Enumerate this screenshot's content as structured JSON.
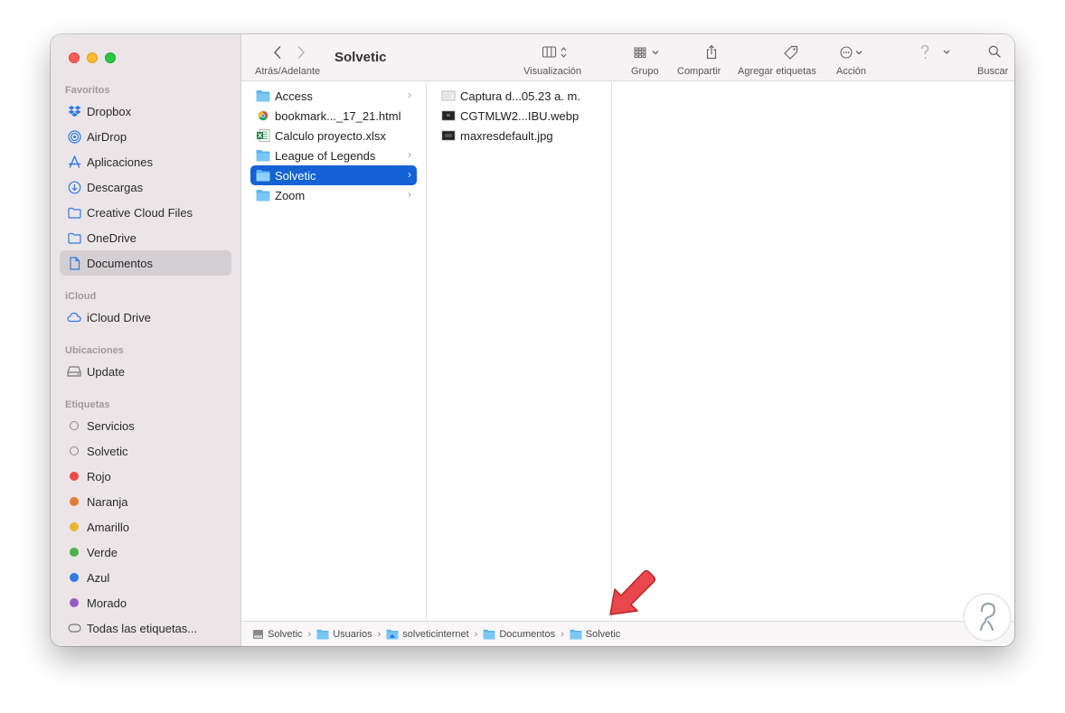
{
  "sidebar": {
    "favorites_title": "Favoritos",
    "favorites": [
      {
        "label": "Dropbox",
        "icon": "dropbox-icon"
      },
      {
        "label": "AirDrop",
        "icon": "airdrop-icon"
      },
      {
        "label": "Aplicaciones",
        "icon": "applications-icon"
      },
      {
        "label": "Descargas",
        "icon": "downloads-icon"
      },
      {
        "label": "Creative Cloud Files",
        "icon": "folder-icon"
      },
      {
        "label": "OneDrive",
        "icon": "folder-icon"
      },
      {
        "label": "Documentos",
        "icon": "document-icon"
      }
    ],
    "icloud_title": "iCloud",
    "icloud": [
      {
        "label": "iCloud Drive",
        "icon": "cloud-icon"
      }
    ],
    "locations_title": "Ubicaciones",
    "locations": [
      {
        "label": "Update",
        "icon": "disk-icon"
      }
    ],
    "tags_title": "Etiquetas",
    "tags": [
      {
        "label": "Servicios",
        "color": "hollow"
      },
      {
        "label": "Solvetic",
        "color": "hollow"
      },
      {
        "label": "Rojo",
        "color": "#ee4b45"
      },
      {
        "label": "Naranja",
        "color": "#e57c35"
      },
      {
        "label": "Amarillo",
        "color": "#e7b530"
      },
      {
        "label": "Verde",
        "color": "#47b349"
      },
      {
        "label": "Azul",
        "color": "#2f7ae5"
      },
      {
        "label": "Morado",
        "color": "#9a5bc6"
      },
      {
        "label": "Todas las etiquetas...",
        "color": "all"
      }
    ]
  },
  "toolbar": {
    "title": "Solvetic",
    "nav_label": "Atrás/Adelante",
    "view_label": "Visualización",
    "group_label": "Grupo",
    "share_label": "Compartir",
    "tags_label": "Agregar etiquetas",
    "action_label": "Acción",
    "search_label": "Buscar"
  },
  "column1": [
    {
      "label": "Access",
      "type": "folder",
      "chevron": true
    },
    {
      "label": "bookmark..._17_21.html",
      "type": "html",
      "chevron": false
    },
    {
      "label": "Calculo proyecto.xlsx",
      "type": "xlsx",
      "chevron": false
    },
    {
      "label": "League of Legends",
      "type": "folder",
      "chevron": true
    },
    {
      "label": "Solvetic",
      "type": "folder",
      "chevron": true,
      "selected": true
    },
    {
      "label": "Zoom",
      "type": "folder",
      "chevron": true
    }
  ],
  "column2": [
    {
      "label": "Captura d...05.23 a. m.",
      "type": "screenshot"
    },
    {
      "label": "CGTMLW2...IBU.webp",
      "type": "image"
    },
    {
      "label": "maxresdefault.jpg",
      "type": "image"
    }
  ],
  "pathbar": [
    {
      "label": "Solvetic",
      "icon": "hdd-icon"
    },
    {
      "label": "Usuarios",
      "icon": "folder-icon"
    },
    {
      "label": "solveticinternet",
      "icon": "home-folder-icon"
    },
    {
      "label": "Documentos",
      "icon": "folder-icon"
    },
    {
      "label": "Solvetic",
      "icon": "folder-icon"
    }
  ],
  "colors": {
    "accent": "#1462d6",
    "folder": "#5eb5ee",
    "annotation_arrow": "#e8474c"
  }
}
